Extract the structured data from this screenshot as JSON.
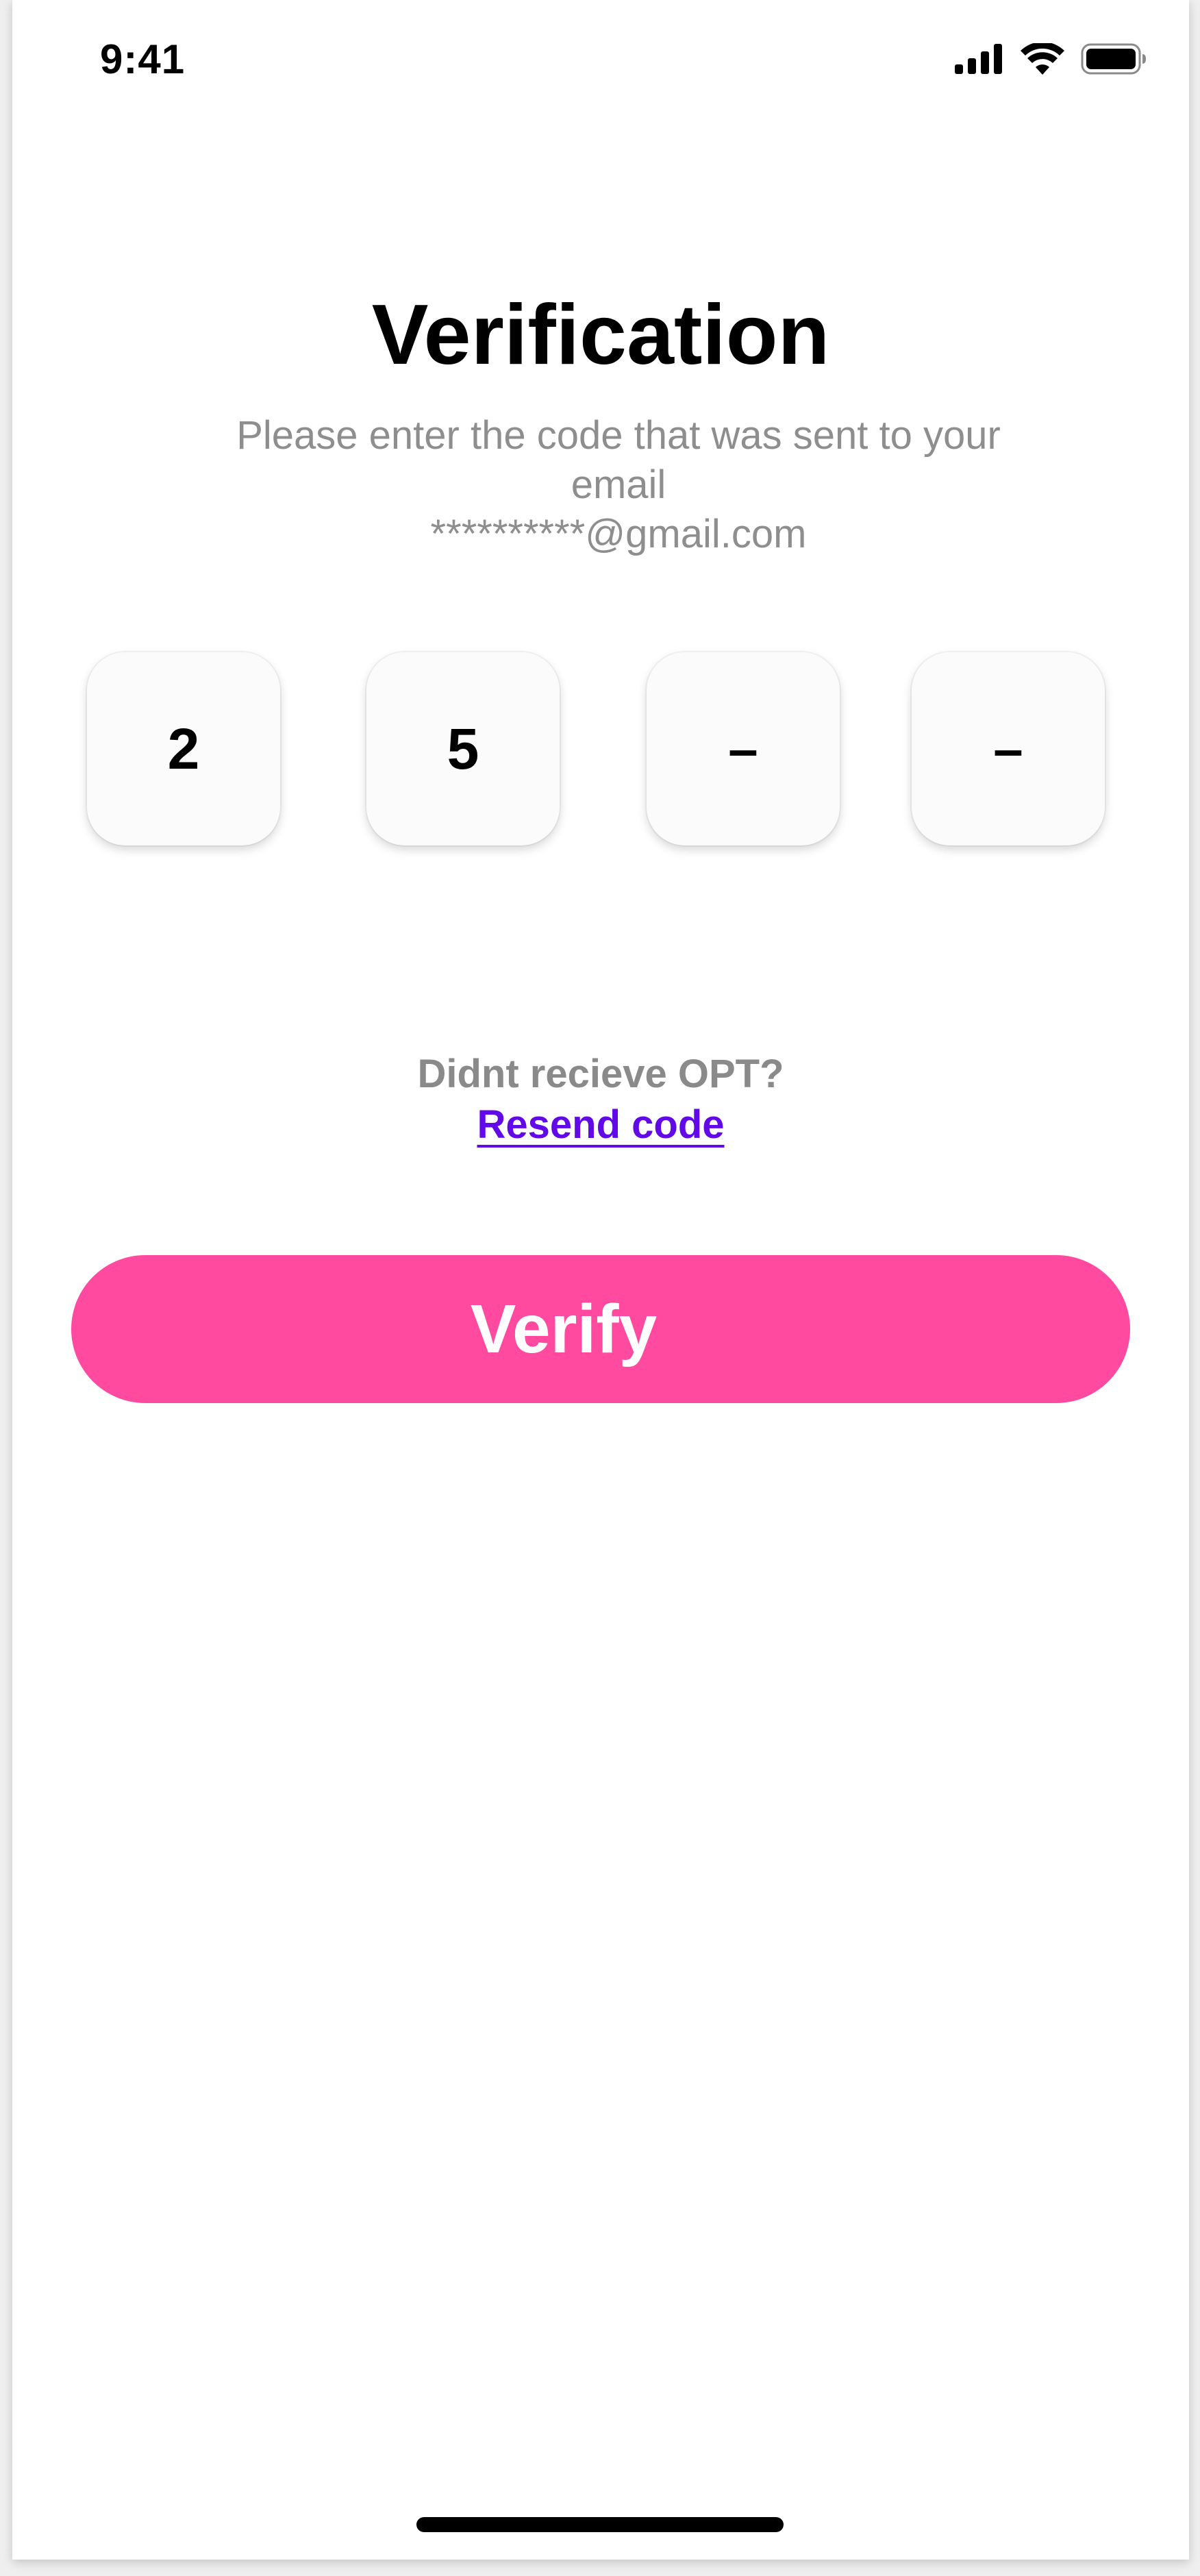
{
  "status_bar": {
    "time": "9:41",
    "icons": [
      "cellular-signal-icon",
      "wifi-icon",
      "battery-icon"
    ]
  },
  "title": "Verification",
  "subtitle": {
    "line1": "Please enter the code that was sent to your",
    "line2": "email",
    "line3": "**********@gmail.com"
  },
  "otp": {
    "digits": [
      "2",
      "5",
      "–",
      "–"
    ]
  },
  "resend": {
    "question": "Didnt recieve OPT?",
    "link_label": "Resend code"
  },
  "verify": {
    "label": "Verify"
  },
  "colors": {
    "accent": "#ff4aa0",
    "link": "#6209e8",
    "muted_text": "#8e8e8e"
  }
}
